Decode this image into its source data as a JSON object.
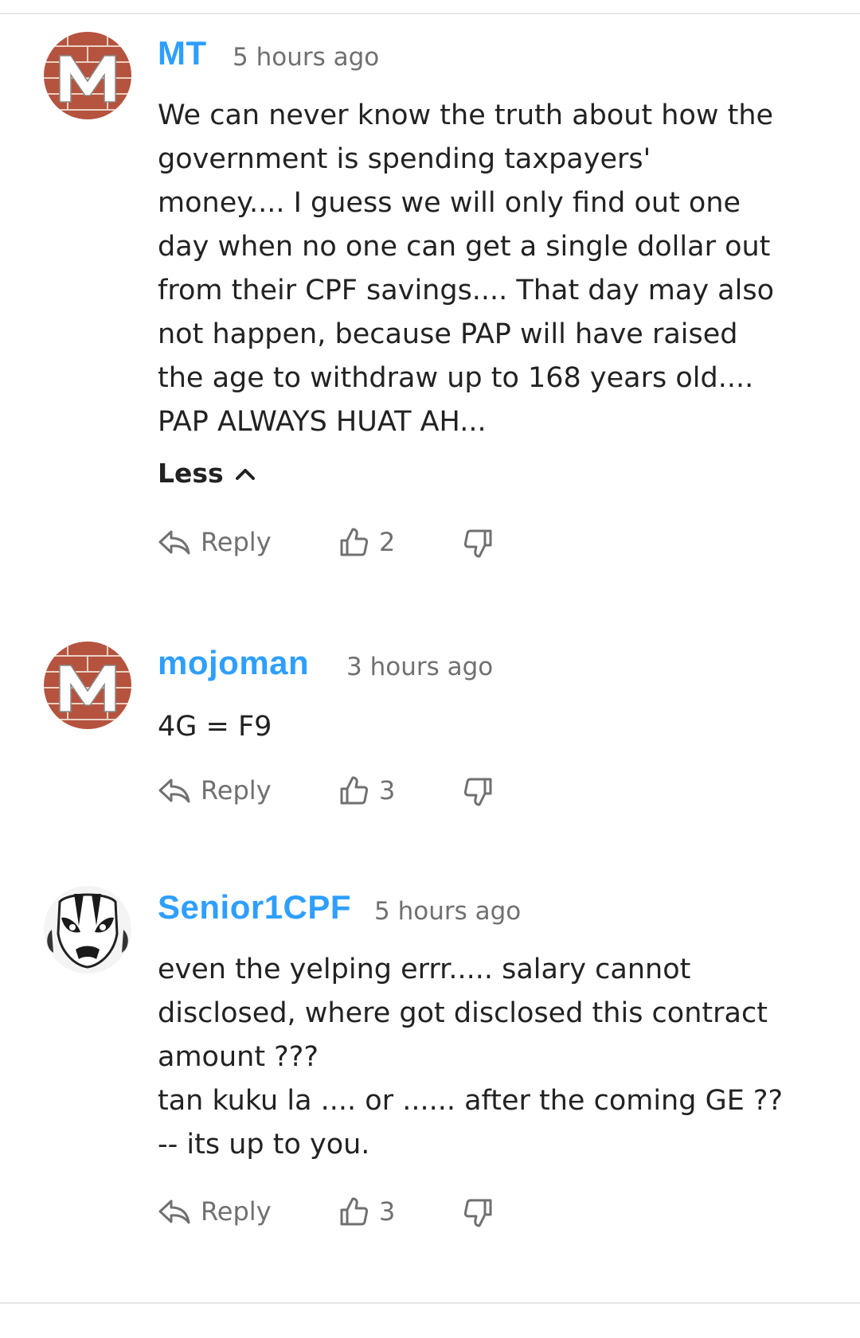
{
  "comments": [
    {
      "username": "MT",
      "time": "5 hours ago",
      "lines": [
        "We can never know the truth about how the",
        "government is spending taxpayers'",
        "money.... I guess we will only find out one",
        "day when no one can get a single dollar out",
        "from their CPF savings.... That day may also",
        "not happen, because PAP will have raised",
        "the age to withdraw up to 168 years old....",
        "PAP ALWAYS HUAT AH..."
      ],
      "less_label": "Less",
      "reply_label": "Reply",
      "upvotes": "2",
      "avatar_icon": "m-brick-avatar-icon"
    },
    {
      "username": "mojoman",
      "time": "3 hours ago",
      "lines": [
        "4G = F9"
      ],
      "reply_label": "Reply",
      "upvotes": "3",
      "avatar_icon": "m-brick-avatar-icon"
    },
    {
      "username": "Senior1CPF",
      "time": "5 hours ago",
      "lines": [
        "even the yelping errr..... salary cannot",
        "disclosed, where got disclosed this contract",
        "amount ???",
        "tan kuku la .... or ...... after the coming GE ??",
        "-- its up to you."
      ],
      "reply_label": "Reply",
      "upvotes": "3",
      "avatar_icon": "masked-face-avatar-icon"
    }
  ],
  "colors": {
    "username": "#2e9fff",
    "meta": "#707070",
    "text": "#222222",
    "divider": "#e6e6e6"
  }
}
